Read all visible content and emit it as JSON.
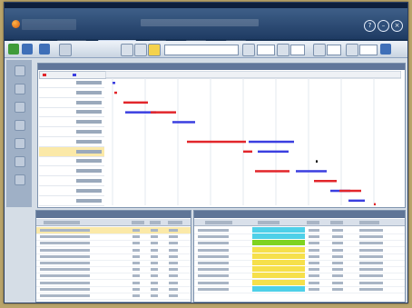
{
  "app": {
    "title": "",
    "brand": "",
    "window_buttons": [
      "",
      "",
      ""
    ]
  },
  "menubar": {
    "items": [
      "",
      "",
      "",
      "",
      "",
      "",
      "",
      ""
    ]
  },
  "subtabs": {
    "items": [
      "",
      "",
      "",
      "",
      ""
    ],
    "active_index": 2
  },
  "toolbar": {
    "buttons": [
      "save-icon",
      "refresh-icon",
      "print-icon",
      "filter-icon"
    ]
  },
  "gantt": {
    "legend": [
      {
        "label": "",
        "color": "#e2262b"
      },
      {
        "label": "",
        "color": "#3b3fe0"
      }
    ],
    "rows": [
      {
        "label": ""
      },
      {
        "label": ""
      },
      {
        "label": ""
      },
      {
        "label": ""
      },
      {
        "label": ""
      },
      {
        "label": ""
      },
      {
        "label": ""
      },
      {
        "label": "",
        "selected": true
      },
      {
        "label": ""
      },
      {
        "label": ""
      },
      {
        "label": ""
      },
      {
        "label": ""
      },
      {
        "label": ""
      }
    ],
    "time_ticks": [
      "",
      "",
      "",
      "",
      "",
      "",
      "",
      "",
      ""
    ],
    "colors": {
      "red": "#e2262b",
      "blue": "#3b3fe0"
    }
  },
  "left_panel": {
    "title": "",
    "columns": [
      "",
      "",
      "",
      ""
    ]
  },
  "right_panel": {
    "title": "",
    "columns": [
      "",
      "",
      "",
      "",
      ""
    ]
  }
}
